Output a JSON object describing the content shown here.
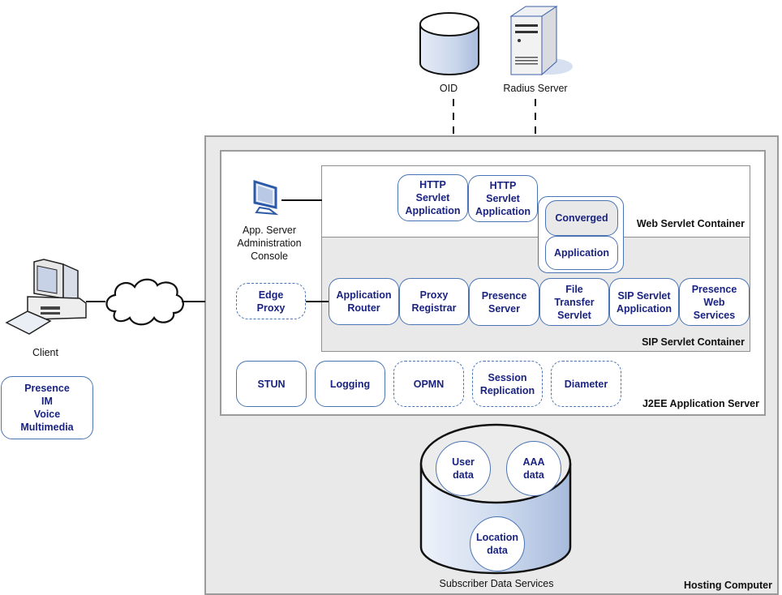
{
  "external": {
    "oid": {
      "label": "OID",
      "icon": "database-icon"
    },
    "radius": {
      "label": "Radius Server",
      "icon": "server-tower-icon"
    }
  },
  "client": {
    "label": "Client",
    "icon": "desktop-computer-icon",
    "network_icon": "cloud-icon",
    "services": [
      "Presence",
      "IM",
      "Voice",
      "Multimedia"
    ]
  },
  "hosting": {
    "label": "Hosting Computer"
  },
  "j2ee": {
    "label": "J2EE Application Server",
    "admin_console": {
      "lines": [
        "App. Server",
        "Administration",
        "Console"
      ],
      "icon": "monitor-icon"
    },
    "edge_proxy": {
      "lines": [
        "Edge",
        "Proxy"
      ],
      "style": "dashed"
    },
    "services": [
      {
        "lines": [
          "STUN"
        ],
        "style": "solid"
      },
      {
        "lines": [
          "Logging"
        ],
        "style": "solid"
      },
      {
        "lines": [
          "OPMN"
        ],
        "style": "dashed"
      },
      {
        "lines": [
          "Session",
          "Replication"
        ],
        "style": "dashed"
      },
      {
        "lines": [
          "Diameter"
        ],
        "style": "dashed"
      }
    ]
  },
  "web_container": {
    "label": "Web Servlet Container",
    "apps": [
      {
        "lines": [
          "HTTP",
          "Servlet",
          "Application"
        ]
      },
      {
        "lines": [
          "HTTP",
          "Servlet",
          "Application"
        ]
      }
    ],
    "converged": {
      "top": "Converged",
      "bottom": "Application"
    }
  },
  "sip_container": {
    "label": "SIP Servlet Container",
    "apps": [
      {
        "lines": [
          "Application",
          "Router"
        ]
      },
      {
        "lines": [
          "Proxy",
          "Registrar"
        ]
      },
      {
        "lines": [
          "Presence",
          "Server"
        ]
      },
      {
        "lines": [
          "File",
          "Transfer",
          "Servlet"
        ]
      },
      {
        "lines": [
          "SIP Servlet",
          "Application"
        ]
      },
      {
        "lines": [
          "Presence",
          "Web",
          "Services"
        ]
      }
    ]
  },
  "subscriber": {
    "label": "Subscriber Data Services",
    "icon": "database-cylinder-icon",
    "stores": [
      {
        "lines": [
          "User",
          "data"
        ]
      },
      {
        "lines": [
          "AAA",
          "data"
        ]
      },
      {
        "lines": [
          "Location",
          "data"
        ]
      }
    ]
  },
  "colors": {
    "box_border": "#4a74b4",
    "box_text": "#1a2380",
    "container_fill": "#e9e9e9",
    "container_border": "#9b9b9b"
  }
}
